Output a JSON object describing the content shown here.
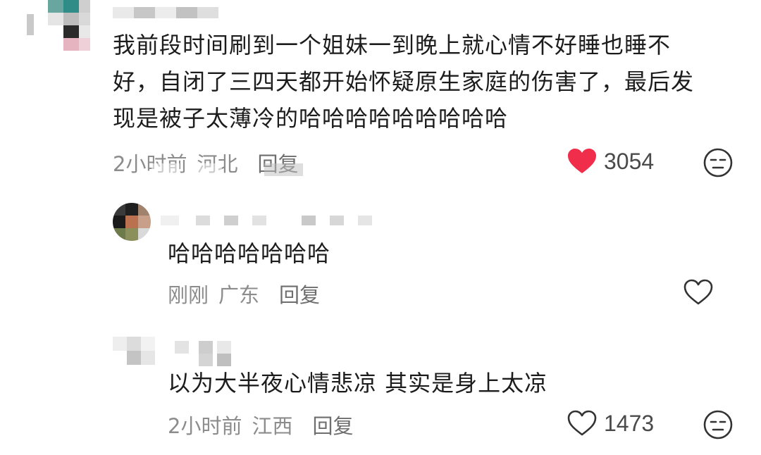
{
  "comments": [
    {
      "text_lines": [
        "我前段时间刷到一个姐妹一到晚上就心情不好睡也睡不",
        "好，自闭了三四天都开始怀疑原生家庭的伤害了，最后发",
        "现是被子太薄冷的哈哈哈哈哈哈哈哈哈"
      ],
      "time": "2小时前",
      "location": "河北",
      "reply_label": "回复",
      "like_count": "3054",
      "liked": true,
      "like_icon": "heart-filled-icon",
      "react_icon": "unamused-face-icon"
    },
    {
      "text_lines": [
        "哈哈哈哈哈哈哈"
      ],
      "time": "刚刚",
      "location": "广东",
      "reply_label": "回复",
      "like_count": "",
      "liked": false,
      "like_icon": "heart-outline-icon"
    },
    {
      "text_lines": [
        "以为大半夜心情悲凉 其实是身上太凉"
      ],
      "time": "2小时前",
      "location": "江西",
      "reply_label": "回复",
      "like_count": "1473",
      "liked": false,
      "like_icon": "heart-outline-icon",
      "react_icon": "unamused-face-icon"
    }
  ],
  "colors": {
    "liked_heart": "#f02d4b",
    "meta_text": "#8c8c8c",
    "body_text": "#1c1c1c"
  }
}
